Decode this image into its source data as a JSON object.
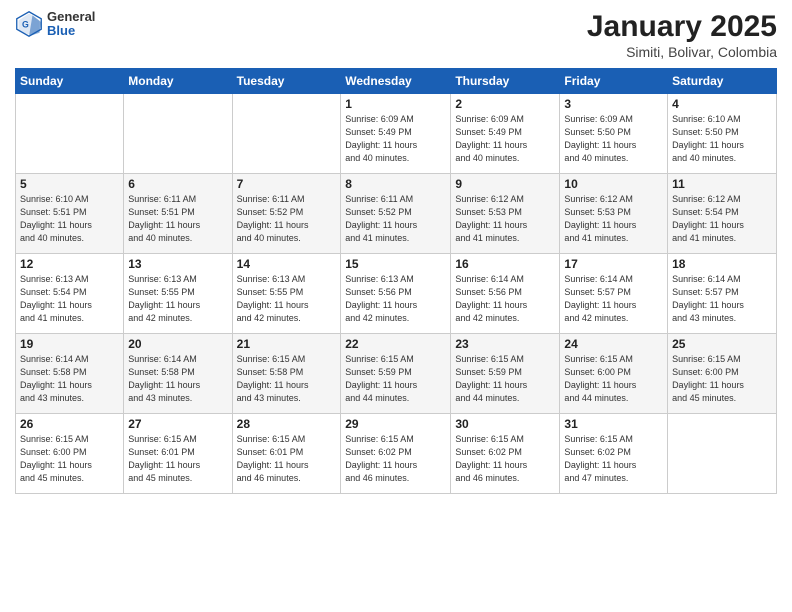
{
  "header": {
    "logo_general": "General",
    "logo_blue": "Blue",
    "month_title": "January 2025",
    "location": "Simiti, Bolivar, Colombia"
  },
  "weekdays": [
    "Sunday",
    "Monday",
    "Tuesday",
    "Wednesday",
    "Thursday",
    "Friday",
    "Saturday"
  ],
  "weeks": [
    [
      {
        "day": "",
        "info": ""
      },
      {
        "day": "",
        "info": ""
      },
      {
        "day": "",
        "info": ""
      },
      {
        "day": "1",
        "info": "Sunrise: 6:09 AM\nSunset: 5:49 PM\nDaylight: 11 hours\nand 40 minutes."
      },
      {
        "day": "2",
        "info": "Sunrise: 6:09 AM\nSunset: 5:49 PM\nDaylight: 11 hours\nand 40 minutes."
      },
      {
        "day": "3",
        "info": "Sunrise: 6:09 AM\nSunset: 5:50 PM\nDaylight: 11 hours\nand 40 minutes."
      },
      {
        "day": "4",
        "info": "Sunrise: 6:10 AM\nSunset: 5:50 PM\nDaylight: 11 hours\nand 40 minutes."
      }
    ],
    [
      {
        "day": "5",
        "info": "Sunrise: 6:10 AM\nSunset: 5:51 PM\nDaylight: 11 hours\nand 40 minutes."
      },
      {
        "day": "6",
        "info": "Sunrise: 6:11 AM\nSunset: 5:51 PM\nDaylight: 11 hours\nand 40 minutes."
      },
      {
        "day": "7",
        "info": "Sunrise: 6:11 AM\nSunset: 5:52 PM\nDaylight: 11 hours\nand 40 minutes."
      },
      {
        "day": "8",
        "info": "Sunrise: 6:11 AM\nSunset: 5:52 PM\nDaylight: 11 hours\nand 41 minutes."
      },
      {
        "day": "9",
        "info": "Sunrise: 6:12 AM\nSunset: 5:53 PM\nDaylight: 11 hours\nand 41 minutes."
      },
      {
        "day": "10",
        "info": "Sunrise: 6:12 AM\nSunset: 5:53 PM\nDaylight: 11 hours\nand 41 minutes."
      },
      {
        "day": "11",
        "info": "Sunrise: 6:12 AM\nSunset: 5:54 PM\nDaylight: 11 hours\nand 41 minutes."
      }
    ],
    [
      {
        "day": "12",
        "info": "Sunrise: 6:13 AM\nSunset: 5:54 PM\nDaylight: 11 hours\nand 41 minutes."
      },
      {
        "day": "13",
        "info": "Sunrise: 6:13 AM\nSunset: 5:55 PM\nDaylight: 11 hours\nand 42 minutes."
      },
      {
        "day": "14",
        "info": "Sunrise: 6:13 AM\nSunset: 5:55 PM\nDaylight: 11 hours\nand 42 minutes."
      },
      {
        "day": "15",
        "info": "Sunrise: 6:13 AM\nSunset: 5:56 PM\nDaylight: 11 hours\nand 42 minutes."
      },
      {
        "day": "16",
        "info": "Sunrise: 6:14 AM\nSunset: 5:56 PM\nDaylight: 11 hours\nand 42 minutes."
      },
      {
        "day": "17",
        "info": "Sunrise: 6:14 AM\nSunset: 5:57 PM\nDaylight: 11 hours\nand 42 minutes."
      },
      {
        "day": "18",
        "info": "Sunrise: 6:14 AM\nSunset: 5:57 PM\nDaylight: 11 hours\nand 43 minutes."
      }
    ],
    [
      {
        "day": "19",
        "info": "Sunrise: 6:14 AM\nSunset: 5:58 PM\nDaylight: 11 hours\nand 43 minutes."
      },
      {
        "day": "20",
        "info": "Sunrise: 6:14 AM\nSunset: 5:58 PM\nDaylight: 11 hours\nand 43 minutes."
      },
      {
        "day": "21",
        "info": "Sunrise: 6:15 AM\nSunset: 5:58 PM\nDaylight: 11 hours\nand 43 minutes."
      },
      {
        "day": "22",
        "info": "Sunrise: 6:15 AM\nSunset: 5:59 PM\nDaylight: 11 hours\nand 44 minutes."
      },
      {
        "day": "23",
        "info": "Sunrise: 6:15 AM\nSunset: 5:59 PM\nDaylight: 11 hours\nand 44 minutes."
      },
      {
        "day": "24",
        "info": "Sunrise: 6:15 AM\nSunset: 6:00 PM\nDaylight: 11 hours\nand 44 minutes."
      },
      {
        "day": "25",
        "info": "Sunrise: 6:15 AM\nSunset: 6:00 PM\nDaylight: 11 hours\nand 45 minutes."
      }
    ],
    [
      {
        "day": "26",
        "info": "Sunrise: 6:15 AM\nSunset: 6:00 PM\nDaylight: 11 hours\nand 45 minutes."
      },
      {
        "day": "27",
        "info": "Sunrise: 6:15 AM\nSunset: 6:01 PM\nDaylight: 11 hours\nand 45 minutes."
      },
      {
        "day": "28",
        "info": "Sunrise: 6:15 AM\nSunset: 6:01 PM\nDaylight: 11 hours\nand 46 minutes."
      },
      {
        "day": "29",
        "info": "Sunrise: 6:15 AM\nSunset: 6:02 PM\nDaylight: 11 hours\nand 46 minutes."
      },
      {
        "day": "30",
        "info": "Sunrise: 6:15 AM\nSunset: 6:02 PM\nDaylight: 11 hours\nand 46 minutes."
      },
      {
        "day": "31",
        "info": "Sunrise: 6:15 AM\nSunset: 6:02 PM\nDaylight: 11 hours\nand 47 minutes."
      },
      {
        "day": "",
        "info": ""
      }
    ]
  ]
}
